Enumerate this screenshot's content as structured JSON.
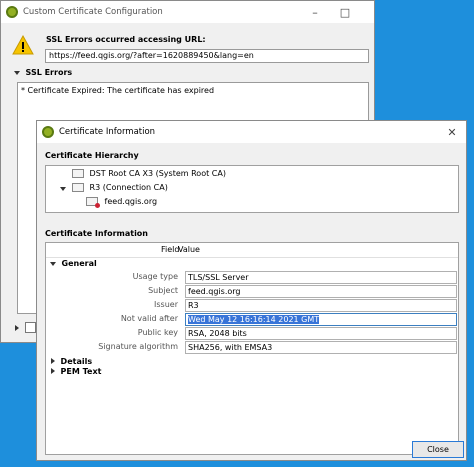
{
  "back_window": {
    "title": "Custom Certificate Configuration",
    "ssl_heading": "SSL Errors occurred accessing URL:",
    "url": "https://feed.qgis.org/?after=1620889450&lang=en",
    "ssl_errors_label": "SSL Errors",
    "error_text": "* Certificate Expired: The certificate has expired"
  },
  "cert_window": {
    "title": "Certificate Information",
    "hierarchy_heading": "Certificate Hierarchy",
    "hierarchy": [
      {
        "label": "DST Root CA X3 (System Root CA)"
      },
      {
        "label": "R3 (Connection CA)"
      },
      {
        "label": "feed.qgis.org"
      }
    ],
    "info_heading": "Certificate Information",
    "columns": {
      "field": "Field",
      "value": "Value"
    },
    "general_label": "General",
    "properties": [
      {
        "label": "Usage type",
        "value": "TLS/SSL Server"
      },
      {
        "label": "Subject",
        "value": "feed.qgis.org"
      },
      {
        "label": "Issuer",
        "value": "R3"
      },
      {
        "label": "Not valid after",
        "value": "Wed May 12 16:16:14 2021 GMT"
      },
      {
        "label": "Public key",
        "value": "RSA, 2048 bits"
      },
      {
        "label": "Signature algorithm",
        "value": "SHA256, with EMSA3"
      }
    ],
    "details_label": "Details",
    "pem_label": "PEM Text",
    "close_label": "Close"
  },
  "colors": {
    "desktop": "#1e8fdc",
    "selection": "#3874d8",
    "qgis_green": "#93b023",
    "warning": "#f6c400"
  },
  "icons": [
    "qgis-logo-icon",
    "warning-icon",
    "certificate-icon",
    "minimize-icon",
    "maximize-icon",
    "close-icon"
  ]
}
